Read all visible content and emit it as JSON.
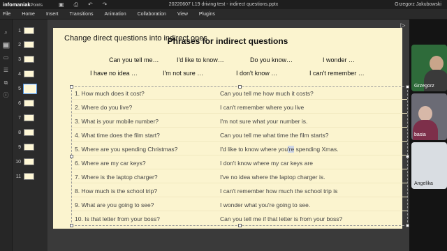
{
  "titlebar": {
    "brand": "infomaniak",
    "brand_suffix": "Points",
    "doc_title": "20220607 L19 driving test - indirect questions.pptx",
    "user": "Grzegorz Jakubowski",
    "icons": [
      "save-icon",
      "print-icon",
      "undo-icon",
      "redo-icon"
    ]
  },
  "menu": [
    "File",
    "Home",
    "Insert",
    "Transitions",
    "Animation",
    "Collaboration",
    "View",
    "Plugins"
  ],
  "leftbar_icons": [
    "search-icon",
    "slides-icon",
    "comments-icon",
    "chat-icon",
    "shapes-icon",
    "info-icon"
  ],
  "thumbnails": [
    "1",
    "2",
    "3",
    "4",
    "5",
    "6",
    "7",
    "8",
    "9",
    "10",
    "11"
  ],
  "selected_slide": 5,
  "slide": {
    "subtitle": "Change direct questions into indirect ones",
    "title": "Phrases for indirect questions",
    "phrases_row1": [
      "Can you tell me…",
      "I'd like to know…",
      "Do you know…",
      "I wonder …"
    ],
    "phrases_row2": [
      "I have no idea …",
      "I'm not sure …",
      "I don't know …",
      "I can't remember …"
    ],
    "rows": [
      {
        "q": "1. How much does it cost?",
        "a": "Can you tell me how much it costs?"
      },
      {
        "q": "2. Where do you live?",
        "a": "I can't remember where you live"
      },
      {
        "q": "3. What is your mobile number?",
        "a": "I'm not sure what your number is."
      },
      {
        "q": "4. What time does the film start?",
        "a": "Can you tell me what time the film starts?"
      },
      {
        "q": "5. Where are you spending Christmas?",
        "a_pre": "I'd like to know where you",
        "a_hl": "'re",
        "a_post": " spending Xmas."
      },
      {
        "q": "6. Where are my car keys?",
        "a": "I don't know where my car keys are"
      },
      {
        "q": "7. Where is the laptop charger?",
        "a": "I've no idea where the laptop charger is."
      },
      {
        "q": "8. How much is the school trip?",
        "a": "I can't remember how much the school trip is"
      },
      {
        "q": "9. What are you going to see?",
        "a": "I wonder what you're going to see."
      },
      {
        "q": "10. Is that letter from your boss?",
        "a": "Can you tell me if that letter is from your boss?"
      }
    ]
  },
  "participants": [
    "Grzegorz",
    "basia",
    "Angelika"
  ],
  "colors": {
    "slide_bg": "#fbf4cf",
    "app_bg": "#2b2b2b",
    "highlight": "#cfd7e6"
  }
}
